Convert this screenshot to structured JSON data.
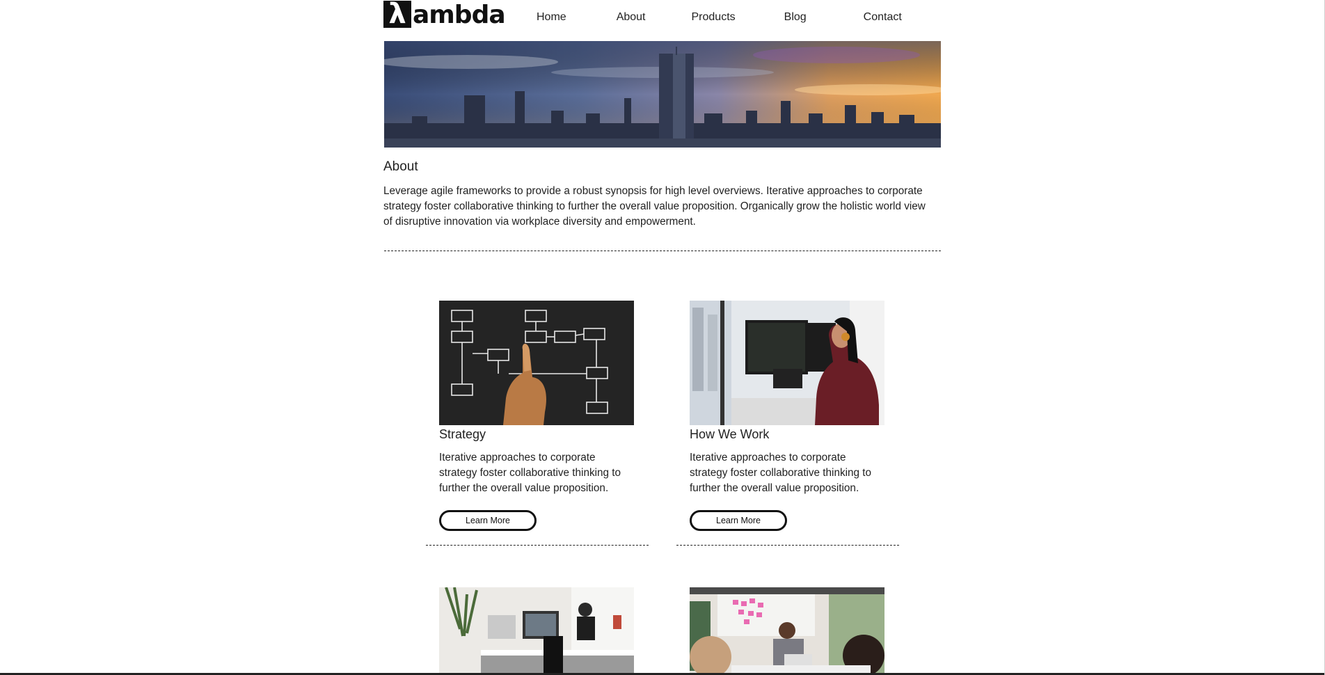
{
  "brand": {
    "logo_mark": "λ",
    "logo_text": "ambda"
  },
  "nav": {
    "items": [
      "Home",
      "About",
      "Products",
      "Blog",
      "Contact"
    ]
  },
  "about": {
    "title": "About",
    "text": "Leverage agile frameworks to provide a robust synopsis for high level overviews. Iterative approaches to corporate strategy foster collaborative thinking to further the overall value proposition. Organically grow the holistic world view of disruptive innovation via workplace diversity and empowerment."
  },
  "cards": [
    {
      "title": "Strategy",
      "text": "Iterative approaches to corporate strategy foster collaborative thinking to further the overall value proposition.",
      "button": "Learn More"
    },
    {
      "title": "How We Work",
      "text": "Iterative approaches to corporate strategy foster collaborative thinking to further the overall value proposition.",
      "button": "Learn More"
    }
  ],
  "colors": {
    "text": "#222222",
    "border": "#111111",
    "background": "#ffffff"
  }
}
